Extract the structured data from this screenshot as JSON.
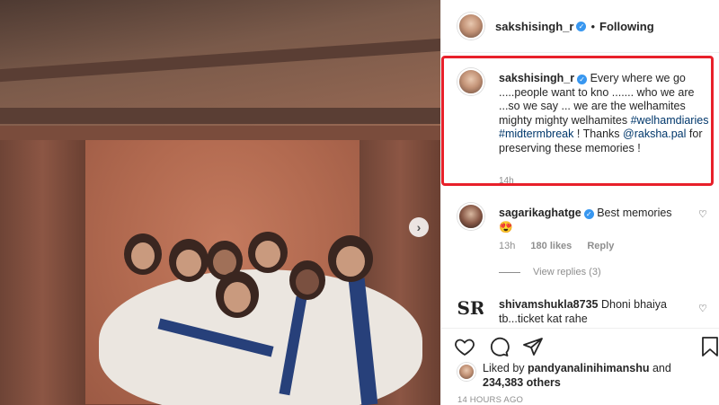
{
  "post": {
    "author": "sakshisingh_r",
    "follow_status": "Following",
    "separator": "•"
  },
  "caption": {
    "author": "sakshisingh_r",
    "text_part1": "Every where we go .....people want to kno ....... who we are ...so we say ... we are the welhamites mighty mighty welhamites",
    "hashtag1": "#welhamdiaries",
    "hashtag2": "#midtermbreak",
    "text_part2": " ! Thanks ",
    "mention": "@raksha.pal",
    "text_part3": " for preserving these memories !",
    "time": "14h"
  },
  "comments": [
    {
      "author": "sagarikaghatge",
      "text": "Best memories",
      "emoji": "😍",
      "time": "13h",
      "likes": "180 likes",
      "reply": "Reply",
      "view_replies": "View replies (3)"
    },
    {
      "author": "shivamshukla8735",
      "text": "Dhoni bhaiya tb...ticket kat rahe"
    }
  ],
  "likes": {
    "prefix": "Liked by ",
    "user": "pandyanalinihimanshu",
    "middle": " and ",
    "count": "234,383 others"
  },
  "timestamp": "14 HOURS AGO",
  "colors": {
    "highlight_box": "#e8202a",
    "link": "#00376b",
    "verified": "#3897f0",
    "muted": "#8e8e8e"
  },
  "icons": {
    "like": "heart-icon",
    "comment": "comment-icon",
    "share": "share-icon",
    "save": "bookmark-icon",
    "carousel_next": "chevron-right-icon",
    "verified": "verified-badge-icon"
  }
}
